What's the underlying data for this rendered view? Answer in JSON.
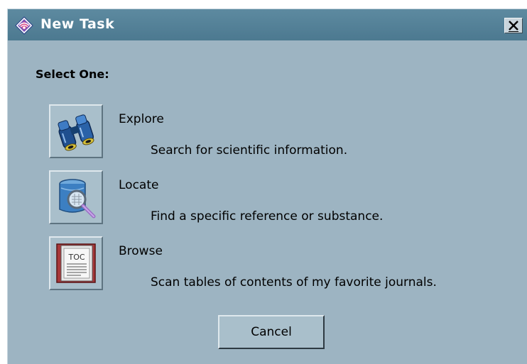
{
  "window": {
    "title": "New Task",
    "close_icon": "close-icon",
    "title_icon": "diamond-logo-icon"
  },
  "heading": "Select One:",
  "options": [
    {
      "icon": "binoculars-icon",
      "title": "Explore",
      "description": "Search for scientific information."
    },
    {
      "icon": "database-search-icon",
      "title": "Locate",
      "description": "Find a specific reference or substance."
    },
    {
      "icon": "toc-book-icon",
      "icon_text": "TOC",
      "title": "Browse",
      "description": "Scan tables of contents of my favorite journals."
    }
  ],
  "cancel_label": "Cancel",
  "colors": {
    "dialog_bg": "#9db4c2",
    "titlebar": "#4c7990",
    "button_face": "#a9bfcb"
  }
}
